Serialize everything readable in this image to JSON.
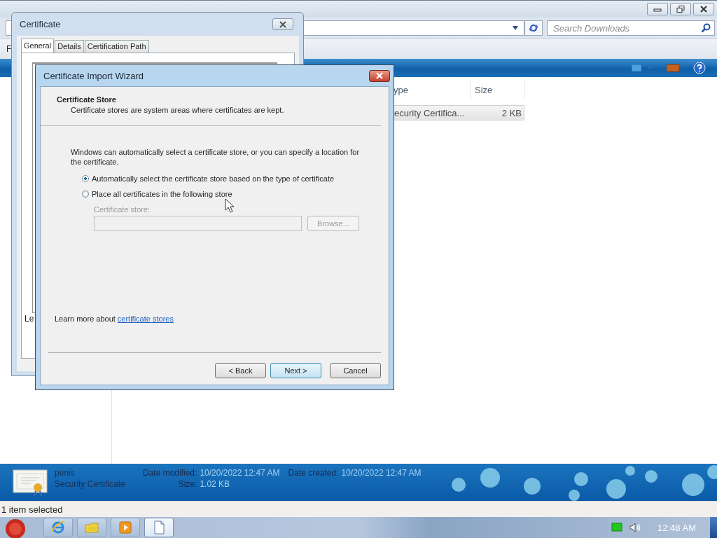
{
  "explorer": {
    "search": {
      "placeholder": "Search Downloads"
    },
    "menu_bar": {
      "items": [
        "F"
      ]
    },
    "file_list": {
      "columns": [
        "ype",
        "Size"
      ],
      "rows": [
        {
          "type": "ecurity Certifica...",
          "size": "2 KB",
          "selected": true
        }
      ]
    },
    "details_pane": {
      "name": "penis",
      "type": "Security Certificate",
      "fields": [
        {
          "label": "Date modified:",
          "value": "10/20/2022 12:47 AM"
        },
        {
          "label": "Date created:",
          "value": "10/20/2022 12:47 AM"
        },
        {
          "label": "Size:",
          "value": "1.02 KB"
        }
      ]
    },
    "status_bar": "1 item selected"
  },
  "taskbar": {
    "buttons": [
      {
        "kind": "browser",
        "active": false
      },
      {
        "kind": "folder",
        "active": false
      },
      {
        "kind": "media",
        "active": false
      },
      {
        "kind": "document",
        "active": true
      }
    ],
    "clock": "12:48 AM"
  },
  "certificate_dialog": {
    "title": "Certificate",
    "tabs": [
      {
        "label": "General",
        "selected": true
      },
      {
        "label": "Details",
        "selected": false
      },
      {
        "label": "Certification Path",
        "selected": false
      }
    ],
    "partial_text": "Le"
  },
  "wizard": {
    "title": "Certificate Import Wizard",
    "heading": "Certificate Store",
    "subheading": "Certificate stores are system areas where certificates are kept.",
    "intro": "Windows can automatically select a certificate store, or you can specify a location for the certificate.",
    "options": [
      {
        "label": "Automatically select the certificate store based on the type of certificate",
        "selected": true
      },
      {
        "label": "Place all certificates in the following store",
        "selected": false
      }
    ],
    "store_label": "Certificate store:",
    "store_disabled": true,
    "browse_button": {
      "label": "Browse...",
      "disabled": true
    },
    "learn_more": {
      "text": "Learn more about",
      "link": "certificate stores"
    },
    "buttons": [
      {
        "label": "< Back",
        "default": false
      },
      {
        "label": "Next >",
        "default": true
      },
      {
        "label": "Cancel",
        "default": false
      }
    ]
  }
}
